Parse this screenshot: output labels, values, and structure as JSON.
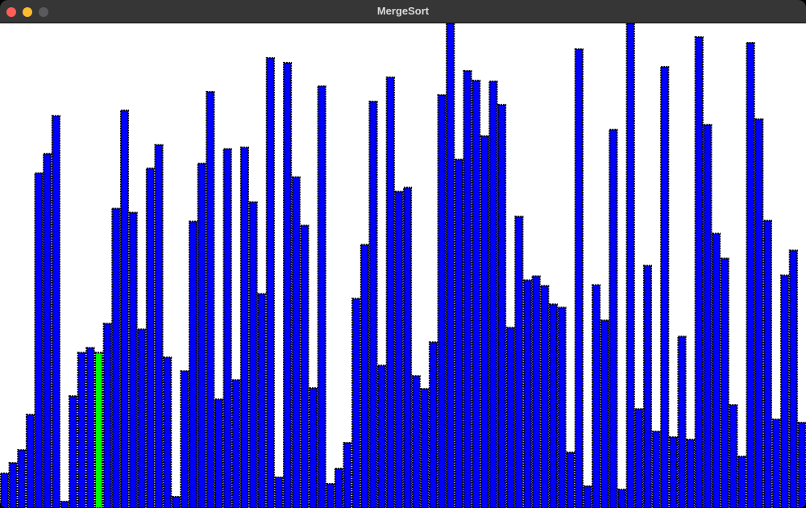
{
  "window": {
    "title": "MergeSort"
  },
  "bars": {
    "max_value": 600,
    "values": [
      43,
      56,
      72,
      116,
      416,
      440,
      487,
      8,
      139,
      193,
      199,
      193,
      229,
      372,
      494,
      367,
      222,
      422,
      451,
      187,
      14,
      170,
      356,
      428,
      517,
      135,
      446,
      159,
      448,
      380,
      266,
      559,
      38,
      553,
      411,
      351,
      149,
      524,
      30,
      49,
      81,
      260,
      327,
      505,
      177,
      535,
      393,
      398,
      164,
      148,
      206,
      513,
      612,
      433,
      543,
      531,
      462,
      530,
      501,
      224,
      362,
      283,
      288,
      276,
      253,
      249,
      69,
      570,
      27,
      277,
      233,
      470,
      23,
      606,
      123,
      301,
      95,
      548,
      88,
      213,
      85,
      585,
      476,
      341,
      310,
      128,
      64,
      578,
      483,
      357,
      110,
      289,
      320,
      106
    ],
    "highlight_index": 11,
    "colors": {
      "bar": "#0000ff",
      "highlight": "#00ff00",
      "outline": "#000000",
      "background": "#ffffff"
    }
  }
}
